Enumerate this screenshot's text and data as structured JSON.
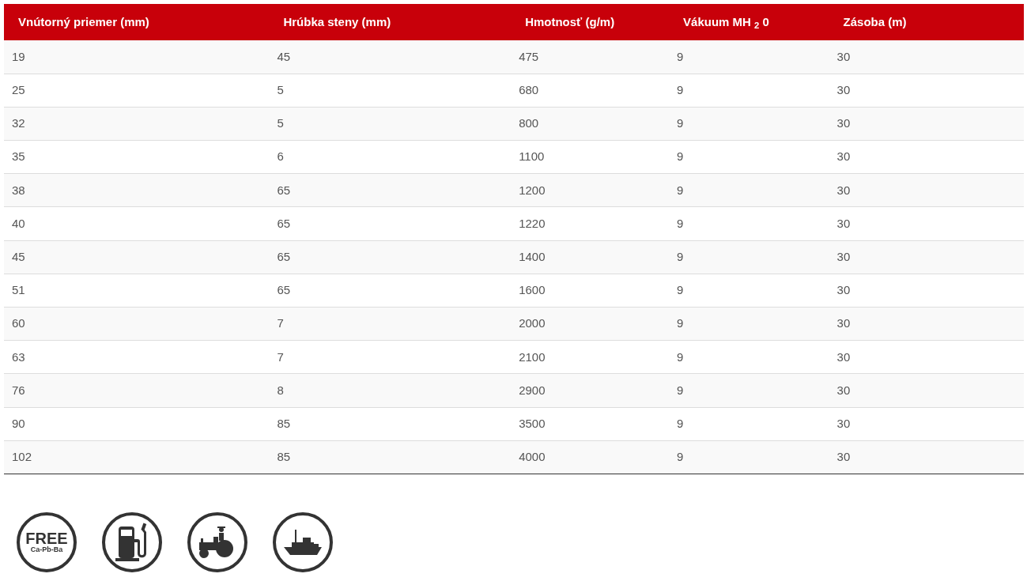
{
  "table": {
    "columns": [
      "Vnútorný priemer (mm)",
      "Hrúbka steny (mm)",
      "Hmotnosť (g/m)",
      "Vákuum MH $_{2}$ 0",
      "Zásoba (m)"
    ],
    "rows": [
      [
        "19",
        "45",
        "475",
        "9",
        "30"
      ],
      [
        "25",
        "5",
        "680",
        "9",
        "30"
      ],
      [
        "32",
        "5",
        "800",
        "9",
        "30"
      ],
      [
        "35",
        "6",
        "1100",
        "9",
        "30"
      ],
      [
        "38",
        "65",
        "1200",
        "9",
        "30"
      ],
      [
        "40",
        "65",
        "1220",
        "9",
        "30"
      ],
      [
        "45",
        "65",
        "1400",
        "9",
        "30"
      ],
      [
        "51",
        "65",
        "1600",
        "9",
        "30"
      ],
      [
        "60",
        "7",
        "2000",
        "9",
        "30"
      ],
      [
        "63",
        "7",
        "2100",
        "9",
        "30"
      ],
      [
        "76",
        "8",
        "2900",
        "9",
        "30"
      ],
      [
        "90",
        "85",
        "3500",
        "9",
        "30"
      ],
      [
        "102",
        "85",
        "4000",
        "9",
        "30"
      ]
    ]
  },
  "badges": [
    {
      "kind": "text",
      "title": "FREE",
      "subtitle": "Ca-Pb-Ba"
    },
    {
      "kind": "fuel"
    },
    {
      "kind": "tractor"
    },
    {
      "kind": "ship"
    }
  ]
}
